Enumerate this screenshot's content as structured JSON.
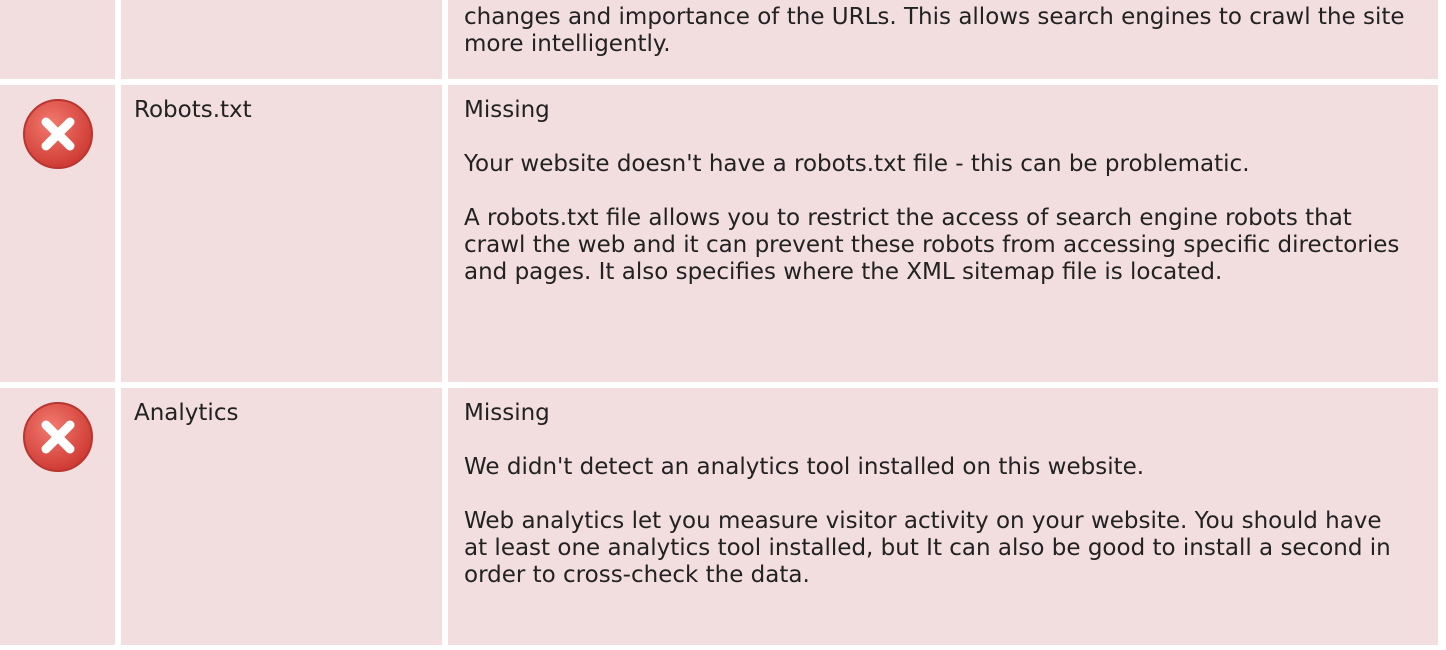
{
  "rows": [
    {
      "label": "",
      "status": "",
      "summary": "",
      "description": "changes and importance of the URLs. This allows search engines to crawl the site more intelligently."
    },
    {
      "label": "Robots.txt",
      "status": "Missing",
      "summary": "Your website doesn't have a robots.txt file - this can be problematic.",
      "description": "A robots.txt file allows you to restrict the access of search engine robots that crawl the web and it can prevent these robots from accessing specific directories and pages. It also specifies where the XML sitemap file is located.",
      "icon": "error-icon"
    },
    {
      "label": "Analytics",
      "status": "Missing",
      "summary": "We didn't detect an analytics tool installed on this website.",
      "description": "Web analytics let you measure visitor activity on your website. You should have at least one analytics tool installed, but It can also be good to install a second in order to cross-check the data.",
      "icon": "error-icon"
    }
  ],
  "colors": {
    "row_background": "#f2dddf",
    "error_red": "#e05050"
  }
}
